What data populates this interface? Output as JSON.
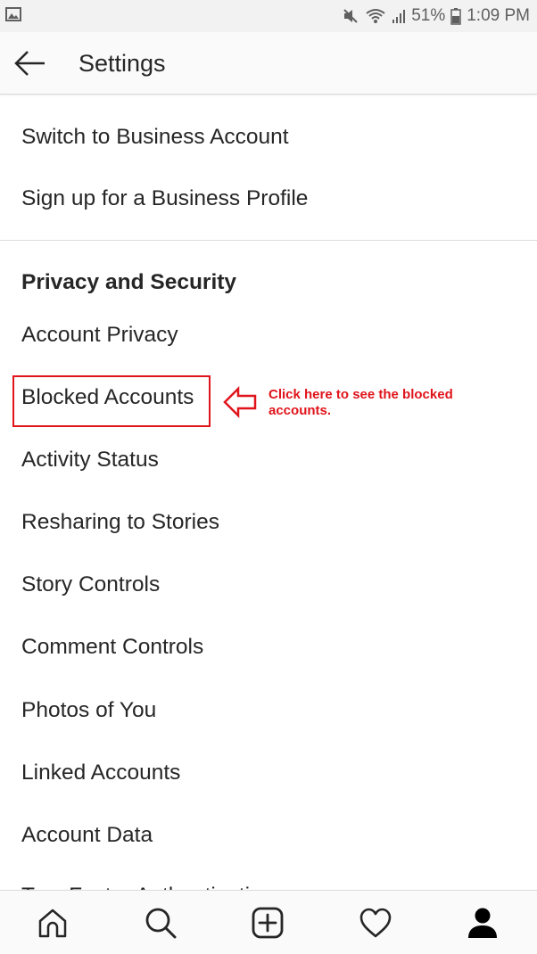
{
  "status_bar": {
    "battery_percent": "51%",
    "time": "1:09 PM",
    "icons": [
      "image-notification-icon",
      "mute-icon",
      "wifi-icon",
      "signal-icon",
      "battery-icon"
    ]
  },
  "header": {
    "title": "Settings",
    "back_icon": "arrow-left-icon"
  },
  "business": {
    "items": [
      {
        "label": "Switch to Business Account"
      },
      {
        "label": "Sign up for a Business Profile"
      }
    ]
  },
  "privacy": {
    "section_title": "Privacy and Security",
    "items": [
      {
        "label": "Account Privacy"
      },
      {
        "label": "Blocked Accounts"
      },
      {
        "label": "Activity Status"
      },
      {
        "label": "Resharing to Stories"
      },
      {
        "label": "Story Controls"
      },
      {
        "label": "Comment Controls"
      },
      {
        "label": "Photos of You"
      },
      {
        "label": "Linked Accounts"
      },
      {
        "label": "Account Data"
      },
      {
        "label": "Two-Factor Authentication"
      }
    ]
  },
  "annotation": {
    "text": "Click here to see the blocked accounts.",
    "color": "#e0141b"
  },
  "bottom_nav": {
    "items": [
      {
        "icon": "home-icon"
      },
      {
        "icon": "search-icon"
      },
      {
        "icon": "add-post-icon"
      },
      {
        "icon": "heart-icon"
      },
      {
        "icon": "profile-icon"
      }
    ]
  }
}
